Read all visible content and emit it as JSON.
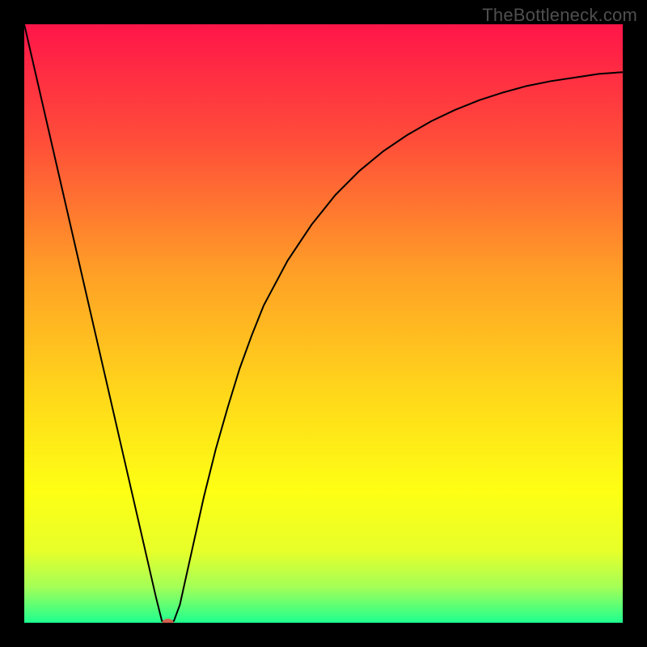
{
  "watermark": "TheBottleneck.com",
  "chart_data": {
    "type": "line",
    "title": "",
    "xlabel": "",
    "ylabel": "",
    "xlim": [
      0,
      100
    ],
    "ylim": [
      0,
      100
    ],
    "grid": false,
    "legend": false,
    "background_gradient": {
      "orientation": "vertical",
      "stops": [
        {
          "offset": 0.0,
          "color": "#ff1549"
        },
        {
          "offset": 0.2,
          "color": "#ff4f39"
        },
        {
          "offset": 0.42,
          "color": "#ffa126"
        },
        {
          "offset": 0.62,
          "color": "#ffd81a"
        },
        {
          "offset": 0.78,
          "color": "#feff14"
        },
        {
          "offset": 0.88,
          "color": "#e7ff2a"
        },
        {
          "offset": 0.94,
          "color": "#a4ff57"
        },
        {
          "offset": 1.0,
          "color": "#1eff8f"
        }
      ]
    },
    "series": [
      {
        "name": "curve",
        "color": "#000000",
        "stroke_width": 2,
        "x": [
          0,
          2,
          4,
          6,
          8,
          10,
          12,
          14,
          16,
          18,
          20,
          22,
          23,
          24,
          25,
          26,
          28,
          30,
          32,
          34,
          36,
          38,
          40,
          44,
          48,
          52,
          56,
          60,
          64,
          68,
          72,
          76,
          80,
          84,
          88,
          92,
          96,
          100
        ],
        "y": [
          100,
          91.3,
          82.6,
          73.9,
          65.2,
          56.5,
          47.8,
          39.1,
          30.4,
          21.7,
          13.0,
          4.3,
          0.3,
          0.0,
          0.3,
          3.0,
          12.0,
          21.0,
          29.0,
          36.0,
          42.5,
          48.0,
          53.0,
          60.5,
          66.5,
          71.5,
          75.5,
          78.8,
          81.5,
          83.8,
          85.7,
          87.3,
          88.6,
          89.7,
          90.5,
          91.1,
          91.7,
          92.0
        ]
      }
    ],
    "marker": {
      "name": "bottleneck-point",
      "x": 24,
      "y": 0,
      "color": "#d1624f",
      "rx": 7,
      "ry": 5
    }
  }
}
